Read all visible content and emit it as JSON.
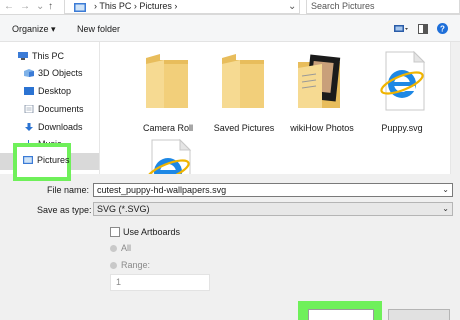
{
  "address": {
    "path": "›  This PC  ›  Pictures  ›",
    "search_placeholder": "Search Pictures"
  },
  "toolbar": {
    "organize": "Organize ▾",
    "new_folder": "New folder"
  },
  "sidebar": {
    "items": [
      {
        "label": "This PC"
      },
      {
        "label": "3D Objects"
      },
      {
        "label": "Desktop"
      },
      {
        "label": "Documents"
      },
      {
        "label": "Downloads"
      },
      {
        "label": "Music"
      },
      {
        "label": "Pictures"
      }
    ]
  },
  "files": [
    {
      "label": "Camera Roll",
      "type": "folder"
    },
    {
      "label": "Saved Pictures",
      "type": "folder"
    },
    {
      "label": "wikiHow Photos",
      "type": "folder-photos"
    },
    {
      "label": "Puppy.svg",
      "type": "svg-file"
    },
    {
      "label": "",
      "type": "svg-file"
    }
  ],
  "form": {
    "file_name_label": "File name:",
    "file_name_value": "cutest_puppy-hd-wallpapers.svg",
    "save_type_label": "Save as type:",
    "save_type_value": "SVG (*.SVG)",
    "use_artboards": "Use Artboards",
    "all": "All",
    "range": "Range:",
    "range_value": "1"
  },
  "colors": {
    "highlight": "#6ff05a",
    "folder": "#f2cf7a",
    "ie_blue": "#1e88e5"
  }
}
